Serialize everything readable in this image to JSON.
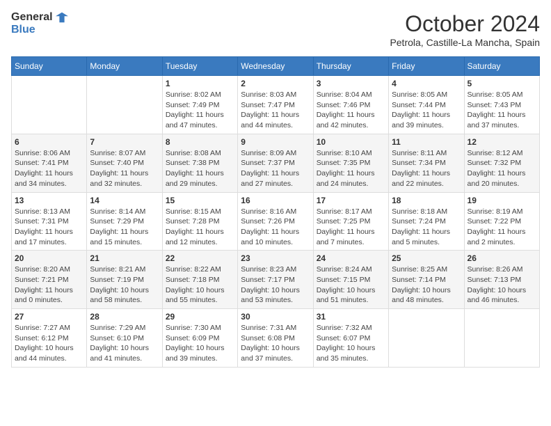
{
  "logo": {
    "line1": "General",
    "line2": "Blue"
  },
  "title": "October 2024",
  "location": "Petrola, Castille-La Mancha, Spain",
  "weekdays": [
    "Sunday",
    "Monday",
    "Tuesday",
    "Wednesday",
    "Thursday",
    "Friday",
    "Saturday"
  ],
  "weeks": [
    [
      {
        "day": "",
        "info": ""
      },
      {
        "day": "",
        "info": ""
      },
      {
        "day": "1",
        "info": "Sunrise: 8:02 AM\nSunset: 7:49 PM\nDaylight: 11 hours and 47 minutes."
      },
      {
        "day": "2",
        "info": "Sunrise: 8:03 AM\nSunset: 7:47 PM\nDaylight: 11 hours and 44 minutes."
      },
      {
        "day": "3",
        "info": "Sunrise: 8:04 AM\nSunset: 7:46 PM\nDaylight: 11 hours and 42 minutes."
      },
      {
        "day": "4",
        "info": "Sunrise: 8:05 AM\nSunset: 7:44 PM\nDaylight: 11 hours and 39 minutes."
      },
      {
        "day": "5",
        "info": "Sunrise: 8:05 AM\nSunset: 7:43 PM\nDaylight: 11 hours and 37 minutes."
      }
    ],
    [
      {
        "day": "6",
        "info": "Sunrise: 8:06 AM\nSunset: 7:41 PM\nDaylight: 11 hours and 34 minutes."
      },
      {
        "day": "7",
        "info": "Sunrise: 8:07 AM\nSunset: 7:40 PM\nDaylight: 11 hours and 32 minutes."
      },
      {
        "day": "8",
        "info": "Sunrise: 8:08 AM\nSunset: 7:38 PM\nDaylight: 11 hours and 29 minutes."
      },
      {
        "day": "9",
        "info": "Sunrise: 8:09 AM\nSunset: 7:37 PM\nDaylight: 11 hours and 27 minutes."
      },
      {
        "day": "10",
        "info": "Sunrise: 8:10 AM\nSunset: 7:35 PM\nDaylight: 11 hours and 24 minutes."
      },
      {
        "day": "11",
        "info": "Sunrise: 8:11 AM\nSunset: 7:34 PM\nDaylight: 11 hours and 22 minutes."
      },
      {
        "day": "12",
        "info": "Sunrise: 8:12 AM\nSunset: 7:32 PM\nDaylight: 11 hours and 20 minutes."
      }
    ],
    [
      {
        "day": "13",
        "info": "Sunrise: 8:13 AM\nSunset: 7:31 PM\nDaylight: 11 hours and 17 minutes."
      },
      {
        "day": "14",
        "info": "Sunrise: 8:14 AM\nSunset: 7:29 PM\nDaylight: 11 hours and 15 minutes."
      },
      {
        "day": "15",
        "info": "Sunrise: 8:15 AM\nSunset: 7:28 PM\nDaylight: 11 hours and 12 minutes."
      },
      {
        "day": "16",
        "info": "Sunrise: 8:16 AM\nSunset: 7:26 PM\nDaylight: 11 hours and 10 minutes."
      },
      {
        "day": "17",
        "info": "Sunrise: 8:17 AM\nSunset: 7:25 PM\nDaylight: 11 hours and 7 minutes."
      },
      {
        "day": "18",
        "info": "Sunrise: 8:18 AM\nSunset: 7:24 PM\nDaylight: 11 hours and 5 minutes."
      },
      {
        "day": "19",
        "info": "Sunrise: 8:19 AM\nSunset: 7:22 PM\nDaylight: 11 hours and 2 minutes."
      }
    ],
    [
      {
        "day": "20",
        "info": "Sunrise: 8:20 AM\nSunset: 7:21 PM\nDaylight: 11 hours and 0 minutes."
      },
      {
        "day": "21",
        "info": "Sunrise: 8:21 AM\nSunset: 7:19 PM\nDaylight: 10 hours and 58 minutes."
      },
      {
        "day": "22",
        "info": "Sunrise: 8:22 AM\nSunset: 7:18 PM\nDaylight: 10 hours and 55 minutes."
      },
      {
        "day": "23",
        "info": "Sunrise: 8:23 AM\nSunset: 7:17 PM\nDaylight: 10 hours and 53 minutes."
      },
      {
        "day": "24",
        "info": "Sunrise: 8:24 AM\nSunset: 7:15 PM\nDaylight: 10 hours and 51 minutes."
      },
      {
        "day": "25",
        "info": "Sunrise: 8:25 AM\nSunset: 7:14 PM\nDaylight: 10 hours and 48 minutes."
      },
      {
        "day": "26",
        "info": "Sunrise: 8:26 AM\nSunset: 7:13 PM\nDaylight: 10 hours and 46 minutes."
      }
    ],
    [
      {
        "day": "27",
        "info": "Sunrise: 7:27 AM\nSunset: 6:12 PM\nDaylight: 10 hours and 44 minutes."
      },
      {
        "day": "28",
        "info": "Sunrise: 7:29 AM\nSunset: 6:10 PM\nDaylight: 10 hours and 41 minutes."
      },
      {
        "day": "29",
        "info": "Sunrise: 7:30 AM\nSunset: 6:09 PM\nDaylight: 10 hours and 39 minutes."
      },
      {
        "day": "30",
        "info": "Sunrise: 7:31 AM\nSunset: 6:08 PM\nDaylight: 10 hours and 37 minutes."
      },
      {
        "day": "31",
        "info": "Sunrise: 7:32 AM\nSunset: 6:07 PM\nDaylight: 10 hours and 35 minutes."
      },
      {
        "day": "",
        "info": ""
      },
      {
        "day": "",
        "info": ""
      }
    ]
  ]
}
